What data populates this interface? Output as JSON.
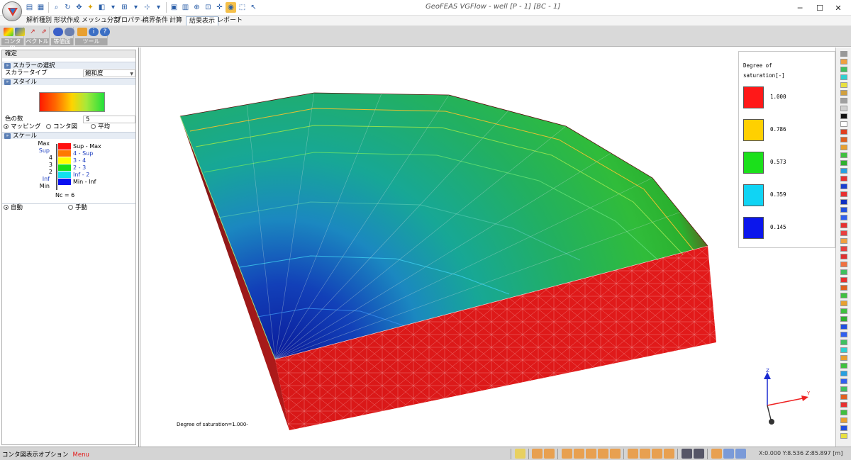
{
  "window": {
    "title": "GeoFEAS VGFlow - well [P - 1] [BC - 1]",
    "minimize": "─",
    "maximize": "☐",
    "close": "✕"
  },
  "ribbon": {
    "tabs": [
      "解析種別",
      "形状作成",
      "メッシュ分割",
      "プロパティ",
      "境界条件",
      "計算",
      "結果表示",
      "レポート"
    ],
    "active_tab": "結果表示",
    "groups": [
      "コンタ図",
      "ベクトル",
      "等値面",
      "ツール"
    ]
  },
  "panel": {
    "confirm": "確定",
    "scalar_section": "スカラーの選択",
    "scalar_type_label": "スカラータイプ",
    "scalar_type_value": "飽和度",
    "style_section": "スタイル",
    "colors_label": "色の数",
    "colors_value": "5",
    "style_options": [
      "マッピング",
      "コンタ図",
      "平均"
    ],
    "scale_section": "スケール",
    "scale_labels": [
      "Max",
      "Sup",
      "4",
      "3",
      "2",
      "Inf",
      "Min"
    ],
    "scale_ranges": [
      "Sup - Max",
      "4 - Sup",
      "3 - 4",
      "2 - 3",
      "Inf - 2",
      "Min - Inf"
    ],
    "nc": "Nc = 6",
    "mode_options": [
      "自動",
      "手動"
    ]
  },
  "viewport": {
    "caption": "Degree of saturation=1.000-",
    "legend": {
      "title_line1": "Degree of",
      "title_line2": "saturation[-]",
      "entries": [
        {
          "value": "1.000",
          "color": "#ff1818"
        },
        {
          "value": "0.786",
          "color": "#ffd000"
        },
        {
          "value": "0.573",
          "color": "#1be01b"
        },
        {
          "value": "0.359",
          "color": "#10d4f4"
        },
        {
          "value": "0.145",
          "color": "#0b16ec"
        }
      ]
    },
    "axes": {
      "z": "Z",
      "y": "Y",
      "x": "X"
    }
  },
  "colors": {
    "red": "#dc1919",
    "dark_red": "#7a1410",
    "green": "#2fb03a",
    "teal": "#12a090",
    "blue": "#0d2fa0"
  },
  "statusbar": {
    "label": "コンタ図表示オプション",
    "menu": "Menu",
    "coords": "X:0.000 Y:8.536 Z:85.897 [m]"
  }
}
